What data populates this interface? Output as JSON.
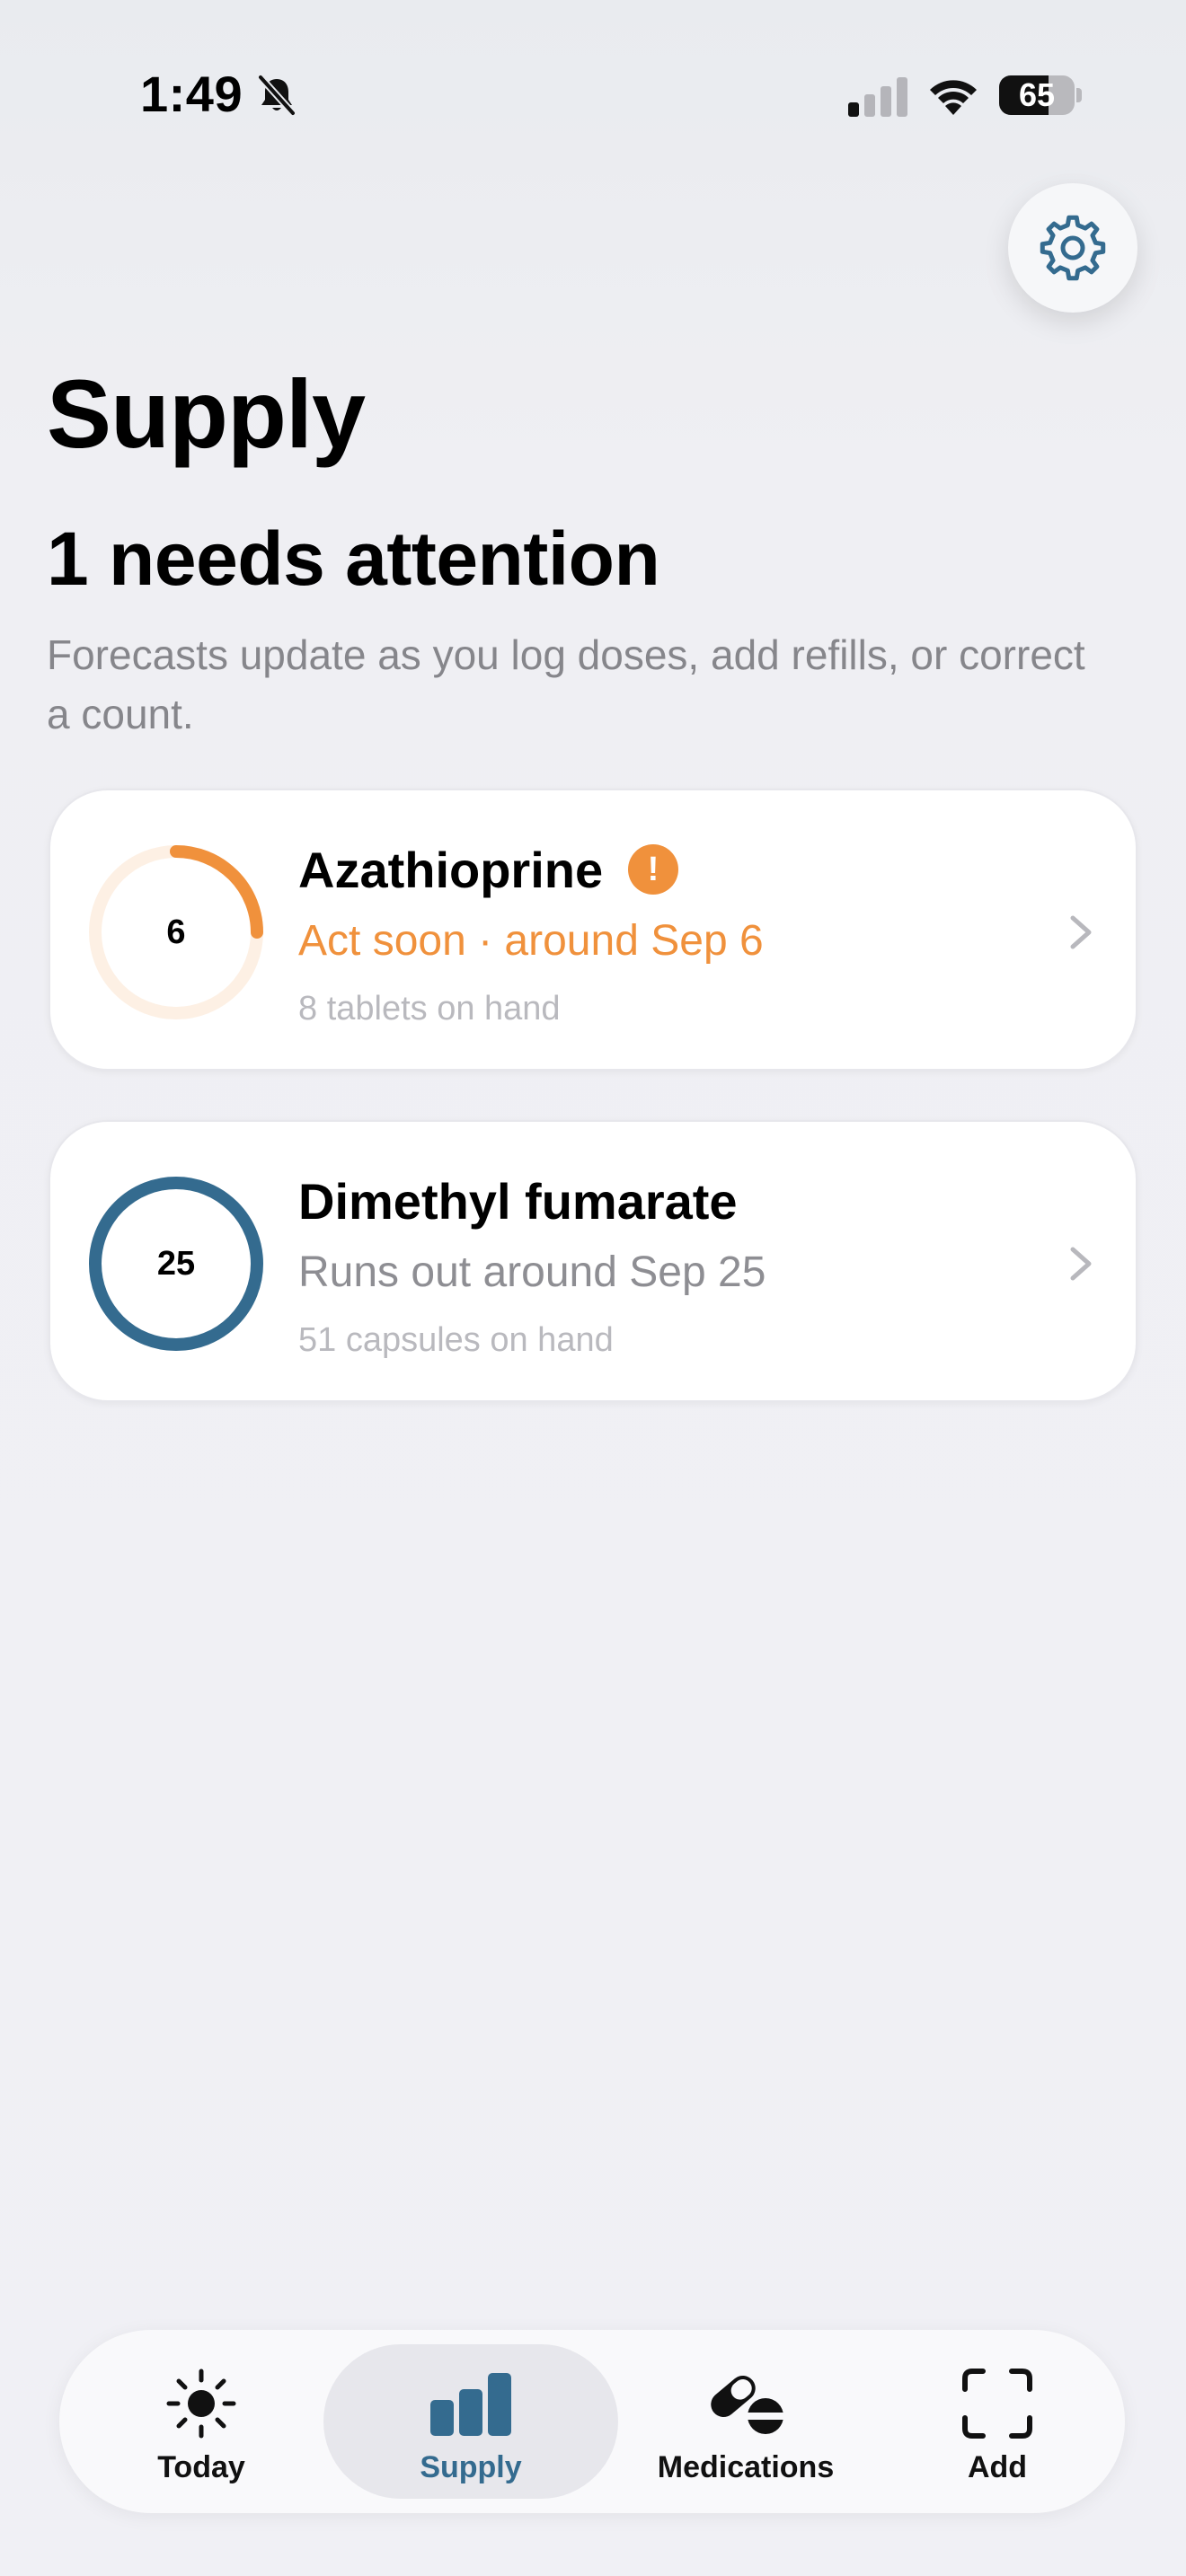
{
  "status_bar": {
    "time": "1:49",
    "battery_percent": "65",
    "battery_level": 0.65
  },
  "settings": {
    "icon": "gear-icon"
  },
  "page": {
    "title": "Supply",
    "attention_heading": "1 needs attention",
    "subtitle": "Forecasts update as you log doses, add refills, or correct a count."
  },
  "medications": [
    {
      "ring_value": "6",
      "ring_fraction": 0.25,
      "name": "Azathioprine",
      "alert_icon": "!",
      "status": "Act soon · around Sep 6",
      "count": "8 tablets on hand",
      "color": "#f0913c",
      "track_color": "#fdf0e4"
    },
    {
      "ring_value": "25",
      "ring_fraction": 1.0,
      "name": "Dimethyl fumarate",
      "status": "Runs out around Sep 25",
      "count": "51 capsules on hand",
      "color": "#346b8f",
      "track_color": "#dbe6ee"
    }
  ],
  "tab_bar": {
    "tabs": [
      {
        "label": "Today",
        "icon": "sun-icon"
      },
      {
        "label": "Supply",
        "icon": "bar-chart-icon",
        "active": true
      },
      {
        "label": "Medications",
        "icon": "pills-icon"
      },
      {
        "label": "Add",
        "icon": "scan-frame-icon"
      }
    ]
  }
}
